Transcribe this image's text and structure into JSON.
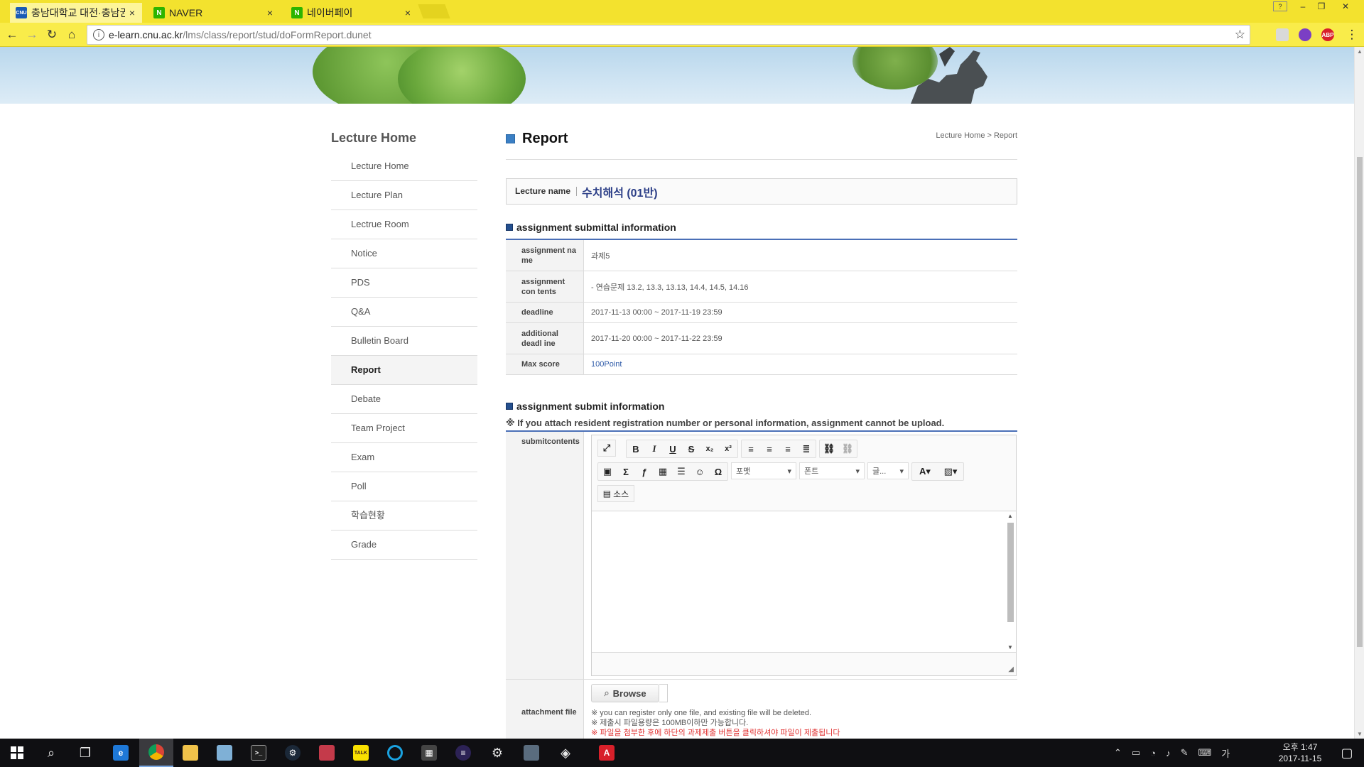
{
  "browser": {
    "tabs": [
      {
        "title": "충남대학교 대전·충남권",
        "favicon": "CNU",
        "color": "#1a5bb5",
        "close": "×"
      },
      {
        "title": "NAVER",
        "favicon": "N",
        "color": "#2db400",
        "close": "×"
      },
      {
        "title": "네이버페이",
        "favicon": "N",
        "color": "#2db400",
        "close": "×"
      }
    ],
    "url_host": "e-learn.cnu.ac.kr",
    "url_path": "/lms/class/report/stud/doFormReport.dunet",
    "info_icon": "i",
    "extensions": [
      {
        "name": "ext-puzzle-icon",
        "label": "",
        "color": "#d9d9d9"
      },
      {
        "name": "ext-purple-icon",
        "label": "",
        "color": "#7b3fc4"
      },
      {
        "name": "adblock-plus-icon",
        "label": "ABP",
        "color": "#d8202a"
      }
    ],
    "icons": {
      "back": "←",
      "forward": "→",
      "reload": "↻",
      "home": "⌂",
      "star": "☆",
      "menu": "⋮"
    },
    "window_controls": {
      "help": "?",
      "minimize": "–",
      "restore": "❐",
      "close": "✕"
    }
  },
  "sidebar": {
    "title": "Lecture Home",
    "items": [
      {
        "label": "Lecture Home"
      },
      {
        "label": "Lecture Plan"
      },
      {
        "label": "Lectrue Room"
      },
      {
        "label": "Notice"
      },
      {
        "label": "PDS"
      },
      {
        "label": "Q&A"
      },
      {
        "label": "Bulletin Board"
      },
      {
        "label": "Report",
        "active": true
      },
      {
        "label": "Debate"
      },
      {
        "label": "Team Project"
      },
      {
        "label": "Exam"
      },
      {
        "label": "Poll"
      },
      {
        "label": "학습현황"
      },
      {
        "label": "Grade"
      }
    ]
  },
  "main": {
    "title": "Report",
    "breadcrumb": "Lecture Home > Report",
    "lecture_label": "Lecture name",
    "lecture_value": "수치해석 (01반)",
    "submittal_heading": "assignment submittal information",
    "info_rows": [
      {
        "label": "assignment na me",
        "value": "과제5"
      },
      {
        "label": "assignment con tents",
        "value": "- 연습문제 13.2, 13.3, 13.13, 14.4, 14.5, 14.16"
      },
      {
        "label": "deadline",
        "value": "2017-11-13 00:00 ~ 2017-11-19 23:59"
      },
      {
        "label": "additional deadl ine",
        "value": "2017-11-20 00:00 ~ 2017-11-22 23:59"
      },
      {
        "label": "Max score",
        "value": "100Point"
      }
    ],
    "submit_heading": "assignment submit information",
    "submit_notice": "※ If you attach resident registration number or personal information, assignment cannot be upload.",
    "submitcontents_label": "submitcontents",
    "editor": {
      "format_placeholder": "포맷",
      "font_placeholder": "폰트",
      "size_placeholder": "글...",
      "source_label": "소스"
    },
    "attachment_label": "attachment file",
    "browse_label": "Browse",
    "attach_notes": [
      "※ you can register only one file, and existing file will be deleted.",
      "※ 제출시 파일용량은 100MB이하만 가능합니다.",
      "※ 파일을 첨부한 후에 하단의 과제제출 버튼을 클릭하셔야 파일이 제출됩니다"
    ]
  },
  "taskbar": {
    "clock_time": "오후 1:47",
    "clock_date": "2017-11-15"
  },
  "colors": {
    "chrome_yellow": "#f3e22e",
    "link_blue": "#2e5aa8",
    "section_rule": "#4a6fb7",
    "warning_red": "#e03030"
  }
}
